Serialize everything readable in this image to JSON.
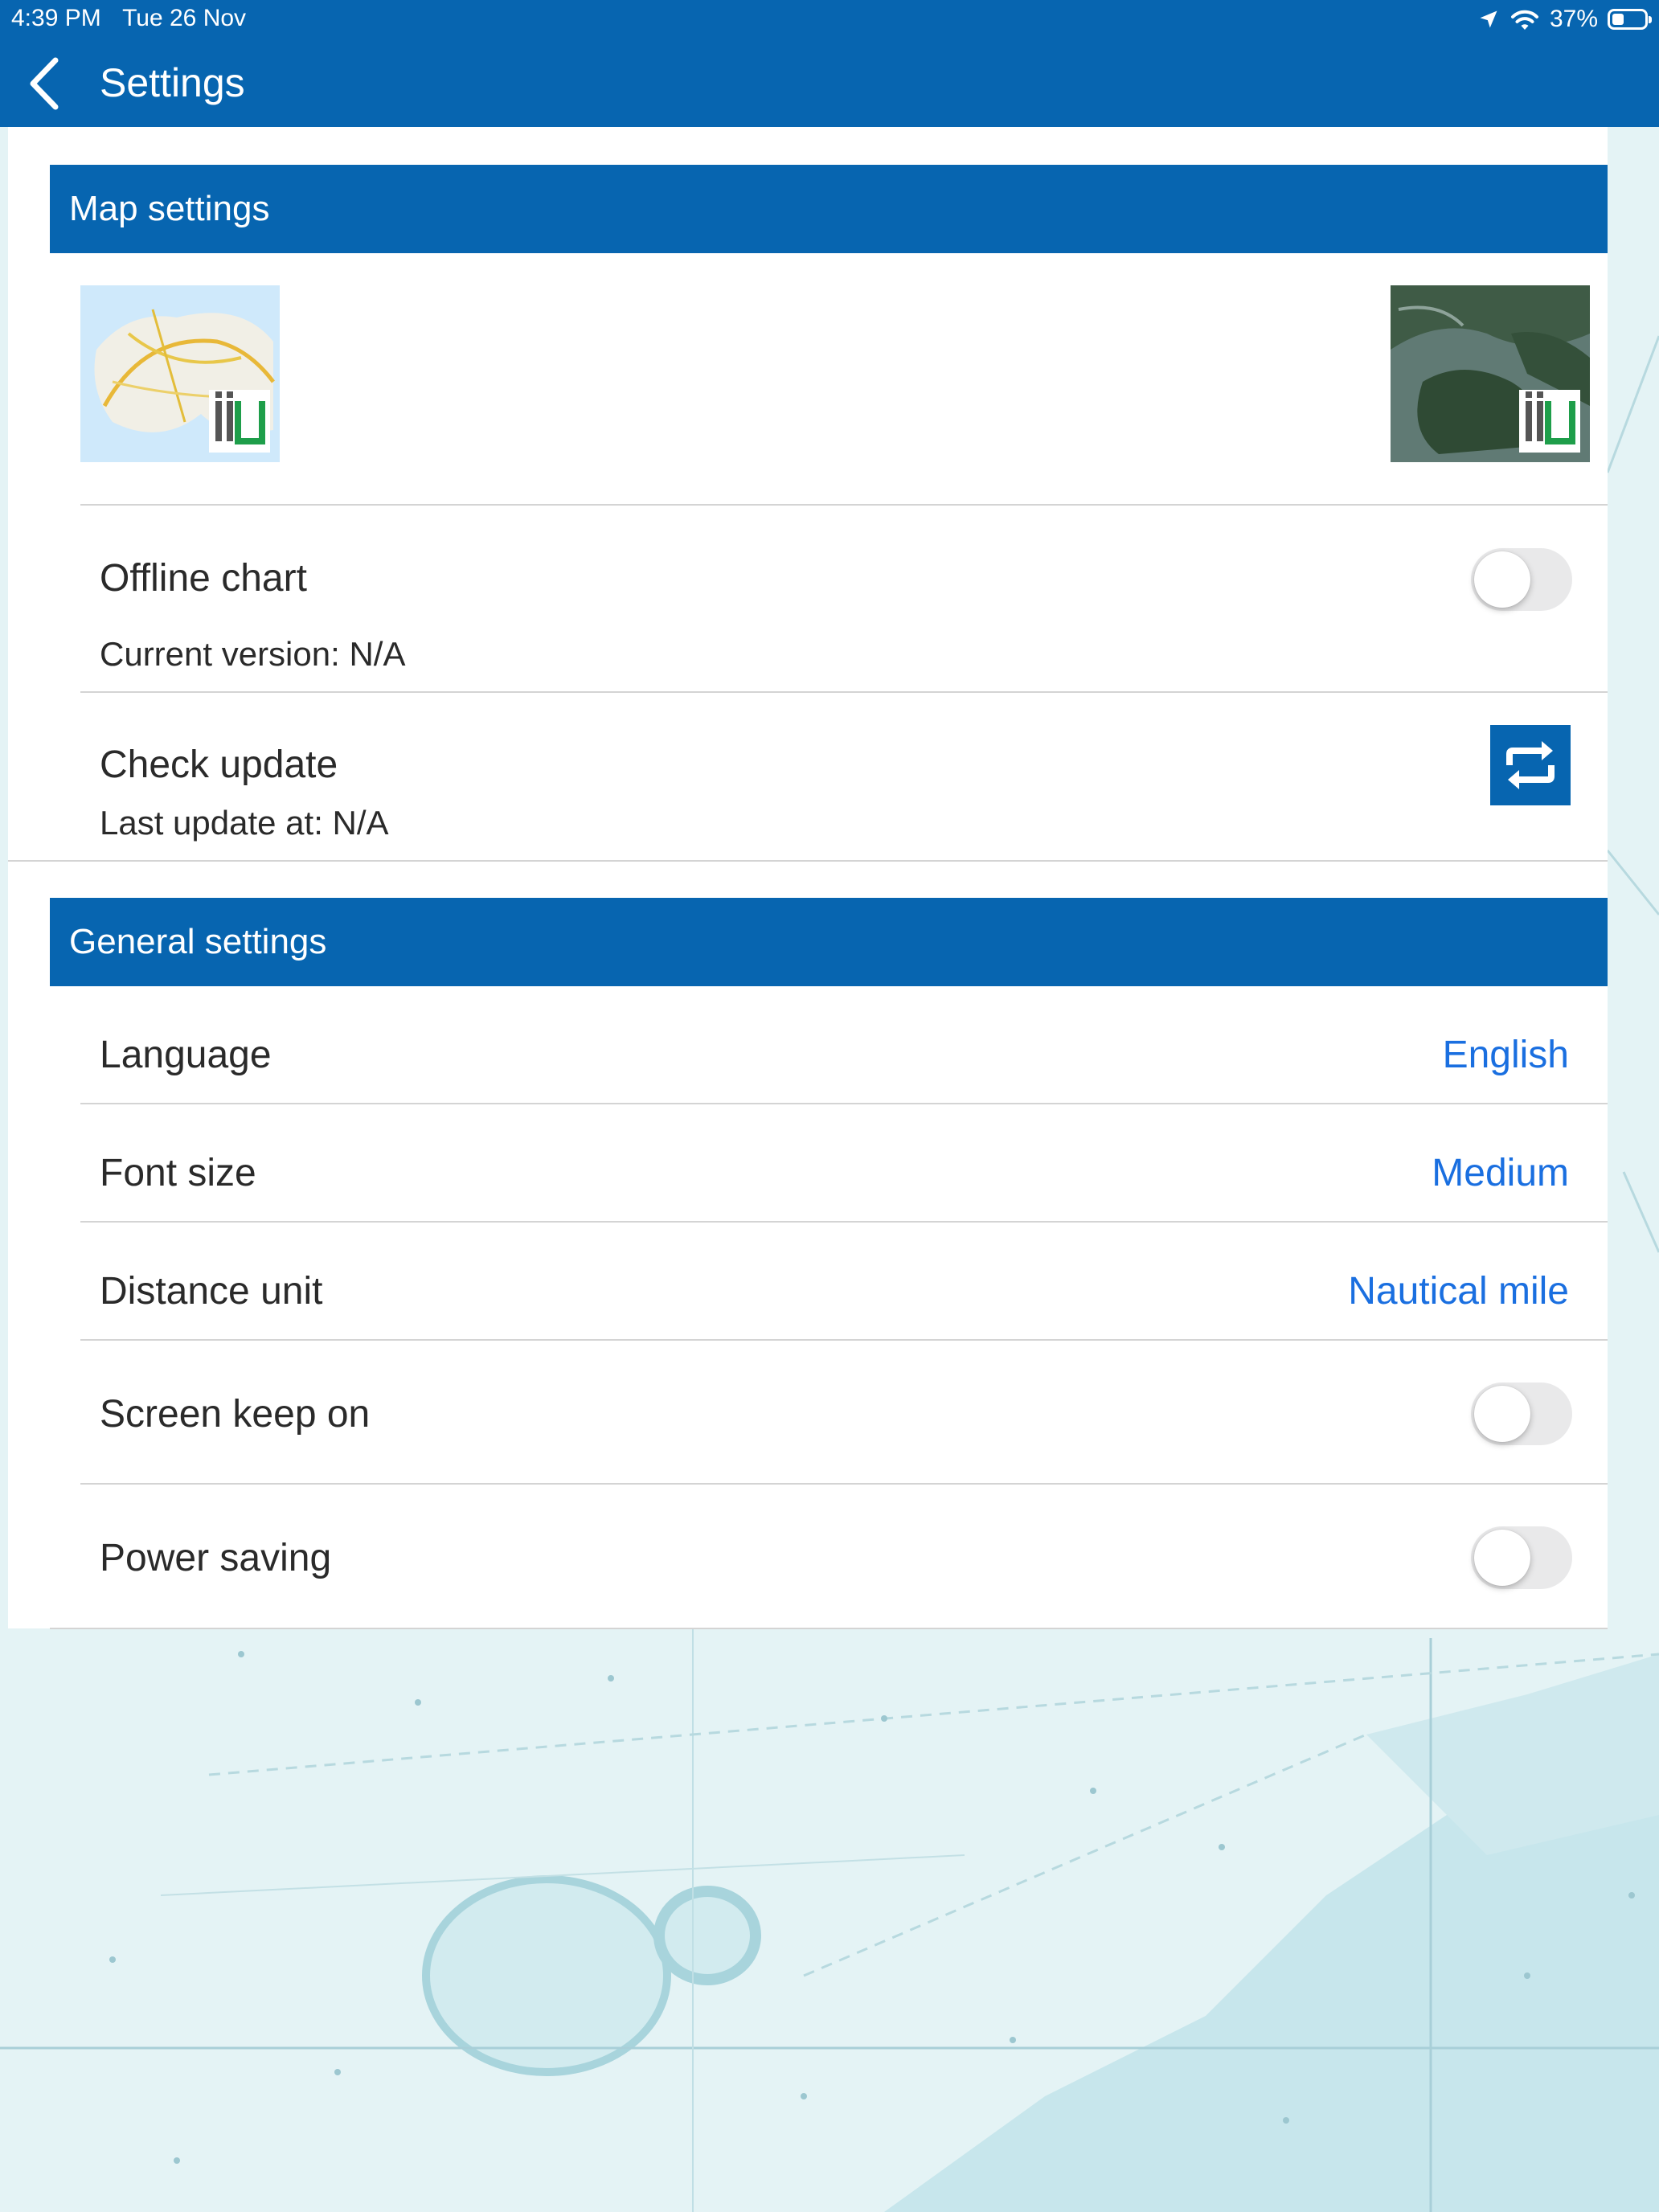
{
  "status_bar": {
    "time": "4:39 PM",
    "date": "Tue 26 Nov",
    "battery": "37%",
    "battery_level": 0.37
  },
  "nav": {
    "title": "Settings",
    "back_icon": "chevron-left-icon"
  },
  "map_settings": {
    "header": "Map settings",
    "offline_chart_label": "Offline chart",
    "offline_chart_on": false,
    "current_version": "Current version: N/A",
    "check_update_label": "Check update",
    "last_update": "Last update at:  N/A"
  },
  "general_settings": {
    "header": "General settings",
    "language_label": "Language",
    "language_value": "English",
    "font_size_label": "Font size",
    "font_size_value": "Medium",
    "distance_unit_label": "Distance unit",
    "distance_unit_value": "Nautical mile",
    "screen_keep_on_label": "Screen keep on",
    "screen_keep_on": false,
    "power_saving_label": "Power saving",
    "power_saving": false
  },
  "colors": {
    "brand": "#0765b0",
    "link": "#1a6fe0",
    "toggle_off": "#e9e9ea"
  }
}
